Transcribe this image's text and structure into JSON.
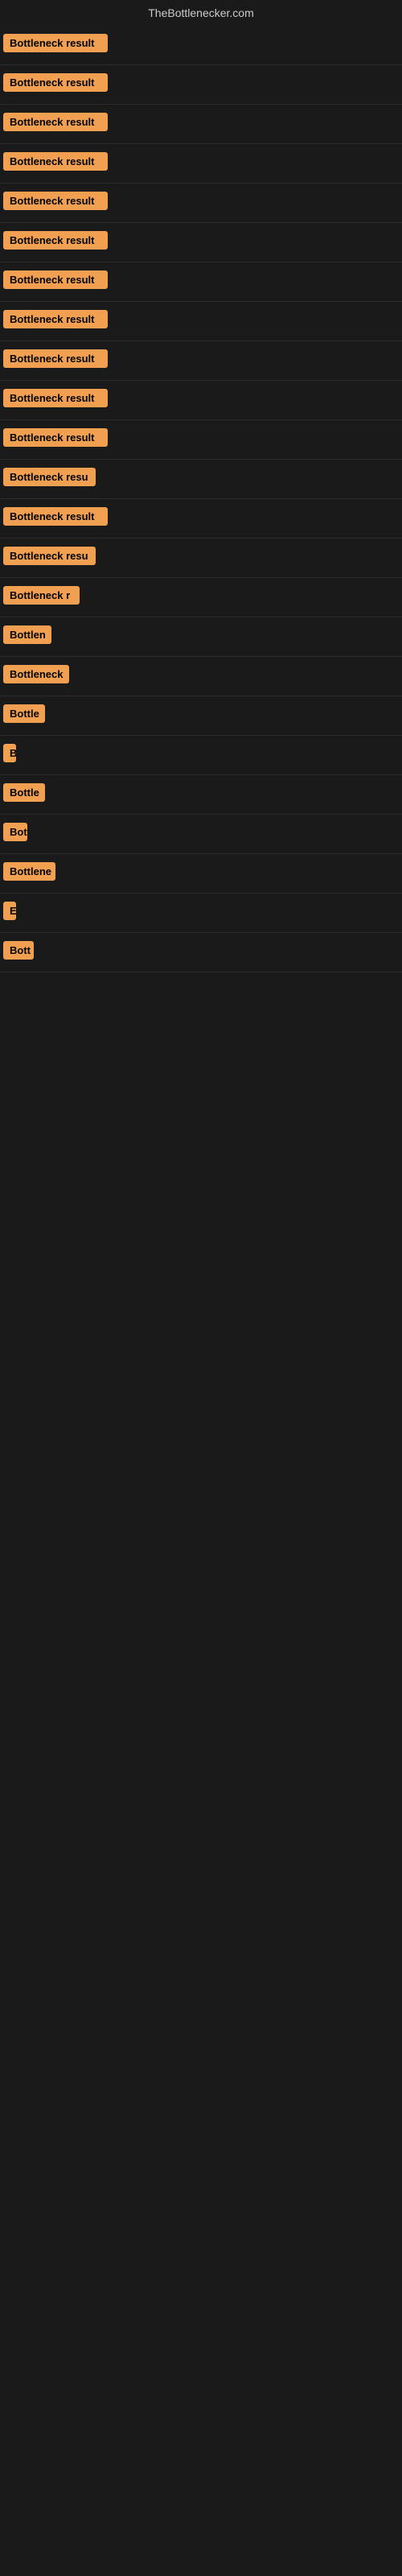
{
  "site": {
    "title": "TheBottlenecker.com"
  },
  "colors": {
    "badge_bg": "#f0a050",
    "badge_text": "#000000",
    "page_bg": "#1a1a1a"
  },
  "results": [
    {
      "id": 1,
      "label": "Bottleneck result",
      "visible_chars": 15
    },
    {
      "id": 2,
      "label": "Bottleneck result",
      "visible_chars": 15
    },
    {
      "id": 3,
      "label": "Bottleneck result",
      "visible_chars": 15
    },
    {
      "id": 4,
      "label": "Bottleneck result",
      "visible_chars": 15
    },
    {
      "id": 5,
      "label": "Bottleneck result",
      "visible_chars": 15
    },
    {
      "id": 6,
      "label": "Bottleneck result",
      "visible_chars": 15
    },
    {
      "id": 7,
      "label": "Bottleneck result",
      "visible_chars": 15
    },
    {
      "id": 8,
      "label": "Bottleneck result",
      "visible_chars": 15
    },
    {
      "id": 9,
      "label": "Bottleneck result",
      "visible_chars": 15
    },
    {
      "id": 10,
      "label": "Bottleneck result",
      "visible_chars": 15
    },
    {
      "id": 11,
      "label": "Bottleneck result",
      "visible_chars": 15
    },
    {
      "id": 12,
      "label": "Bottleneck resu",
      "visible_chars": 14
    },
    {
      "id": 13,
      "label": "Bottleneck result",
      "visible_chars": 15
    },
    {
      "id": 14,
      "label": "Bottleneck resu",
      "visible_chars": 14
    },
    {
      "id": 15,
      "label": "Bottleneck r",
      "visible_chars": 12
    },
    {
      "id": 16,
      "label": "Bottlen",
      "visible_chars": 7
    },
    {
      "id": 17,
      "label": "Bottleneck",
      "visible_chars": 10
    },
    {
      "id": 18,
      "label": "Bottle",
      "visible_chars": 6
    },
    {
      "id": 19,
      "label": "B",
      "visible_chars": 1
    },
    {
      "id": 20,
      "label": "Bottle",
      "visible_chars": 6
    },
    {
      "id": 21,
      "label": "Bot",
      "visible_chars": 3
    },
    {
      "id": 22,
      "label": "Bottlene",
      "visible_chars": 8
    },
    {
      "id": 23,
      "label": "E",
      "visible_chars": 1
    },
    {
      "id": 24,
      "label": "Bott",
      "visible_chars": 4
    }
  ]
}
